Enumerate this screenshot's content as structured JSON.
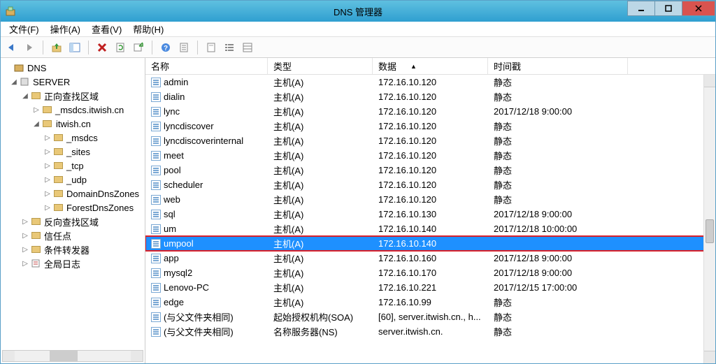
{
  "window": {
    "title": "DNS 管理器"
  },
  "menu": {
    "file": "文件(F)",
    "action": "操作(A)",
    "view": "查看(V)",
    "help": "帮助(H)"
  },
  "tree": {
    "root": "DNS",
    "server": "SERVER",
    "fwd": "正向查找区域",
    "msdcs": "_msdcs.itwish.cn",
    "zone": "itwish.cn",
    "sub": [
      "_msdcs",
      "_sites",
      "_tcp",
      "_udp",
      "DomainDnsZones",
      "ForestDnsZones"
    ],
    "rev": "反向查找区域",
    "trust": "信任点",
    "fwdr": "条件转发器",
    "log": "全局日志"
  },
  "columns": {
    "name": "名称",
    "type": "类型",
    "data": "数据",
    "ts": "时间戳"
  },
  "records": [
    {
      "name": "admin",
      "type": "主机(A)",
      "data": "172.16.10.120",
      "ts": "静态"
    },
    {
      "name": "dialin",
      "type": "主机(A)",
      "data": "172.16.10.120",
      "ts": "静态"
    },
    {
      "name": "lync",
      "type": "主机(A)",
      "data": "172.16.10.120",
      "ts": "2017/12/18 9:00:00"
    },
    {
      "name": "lyncdiscover",
      "type": "主机(A)",
      "data": "172.16.10.120",
      "ts": "静态"
    },
    {
      "name": "lyncdiscoverinternal",
      "type": "主机(A)",
      "data": "172.16.10.120",
      "ts": "静态"
    },
    {
      "name": "meet",
      "type": "主机(A)",
      "data": "172.16.10.120",
      "ts": "静态"
    },
    {
      "name": "pool",
      "type": "主机(A)",
      "data": "172.16.10.120",
      "ts": "静态"
    },
    {
      "name": "scheduler",
      "type": "主机(A)",
      "data": "172.16.10.120",
      "ts": "静态"
    },
    {
      "name": "web",
      "type": "主机(A)",
      "data": "172.16.10.120",
      "ts": "静态"
    },
    {
      "name": "sql",
      "type": "主机(A)",
      "data": "172.16.10.130",
      "ts": "2017/12/18 9:00:00"
    },
    {
      "name": "um",
      "type": "主机(A)",
      "data": "172.16.10.140",
      "ts": "2017/12/18 10:00:00"
    },
    {
      "name": "umpool",
      "type": "主机(A)",
      "data": "172.16.10.140",
      "ts": "",
      "sel": true,
      "hl": true
    },
    {
      "name": "app",
      "type": "主机(A)",
      "data": "172.16.10.160",
      "ts": "2017/12/18 9:00:00"
    },
    {
      "name": "mysql2",
      "type": "主机(A)",
      "data": "172.16.10.170",
      "ts": "2017/12/18 9:00:00"
    },
    {
      "name": "Lenovo-PC",
      "type": "主机(A)",
      "data": "172.16.10.221",
      "ts": "2017/12/15 17:00:00"
    },
    {
      "name": "edge",
      "type": "主机(A)",
      "data": "172.16.10.99",
      "ts": "静态"
    },
    {
      "name": "(与父文件夹相同)",
      "type": "起始授权机构(SOA)",
      "data": "[60], server.itwish.cn., h...",
      "ts": "静态"
    },
    {
      "name": "(与父文件夹相同)",
      "type": "名称服务器(NS)",
      "data": "server.itwish.cn.",
      "ts": "静态"
    }
  ]
}
